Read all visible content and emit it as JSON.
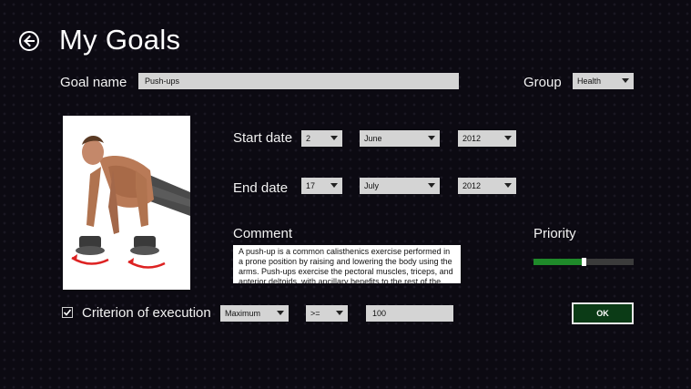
{
  "header": {
    "title": "My Goals",
    "back_icon": "arrow-left-circle-icon"
  },
  "goal_name": {
    "label": "Goal name",
    "value": "Push-ups"
  },
  "group": {
    "label": "Group",
    "selected": "Health"
  },
  "start_date": {
    "label": "Start date",
    "day": "2",
    "month": "June",
    "year": "2012"
  },
  "end_date": {
    "label": "End date",
    "day": "17",
    "month": "July",
    "year": "2012"
  },
  "comment": {
    "label": "Comment",
    "text": "A push-up is a common calisthenics exercise performed in a prone position by raising and lowering the body using the arms. Push-ups exercise the pectoral muscles, triceps, and anterior deltoids, with ancillary benefits to the rest of the deltoids"
  },
  "priority": {
    "label": "Priority",
    "level": 0.5,
    "fill_color": "#1f8a2a"
  },
  "criterion": {
    "label": "Criterion of execution",
    "checked": true,
    "type": "Maximum",
    "operator": ">=",
    "value": "100"
  },
  "ok_button": {
    "label": "OK",
    "background": "#0b3b16"
  },
  "image": {
    "icon": "push-up-photo"
  }
}
